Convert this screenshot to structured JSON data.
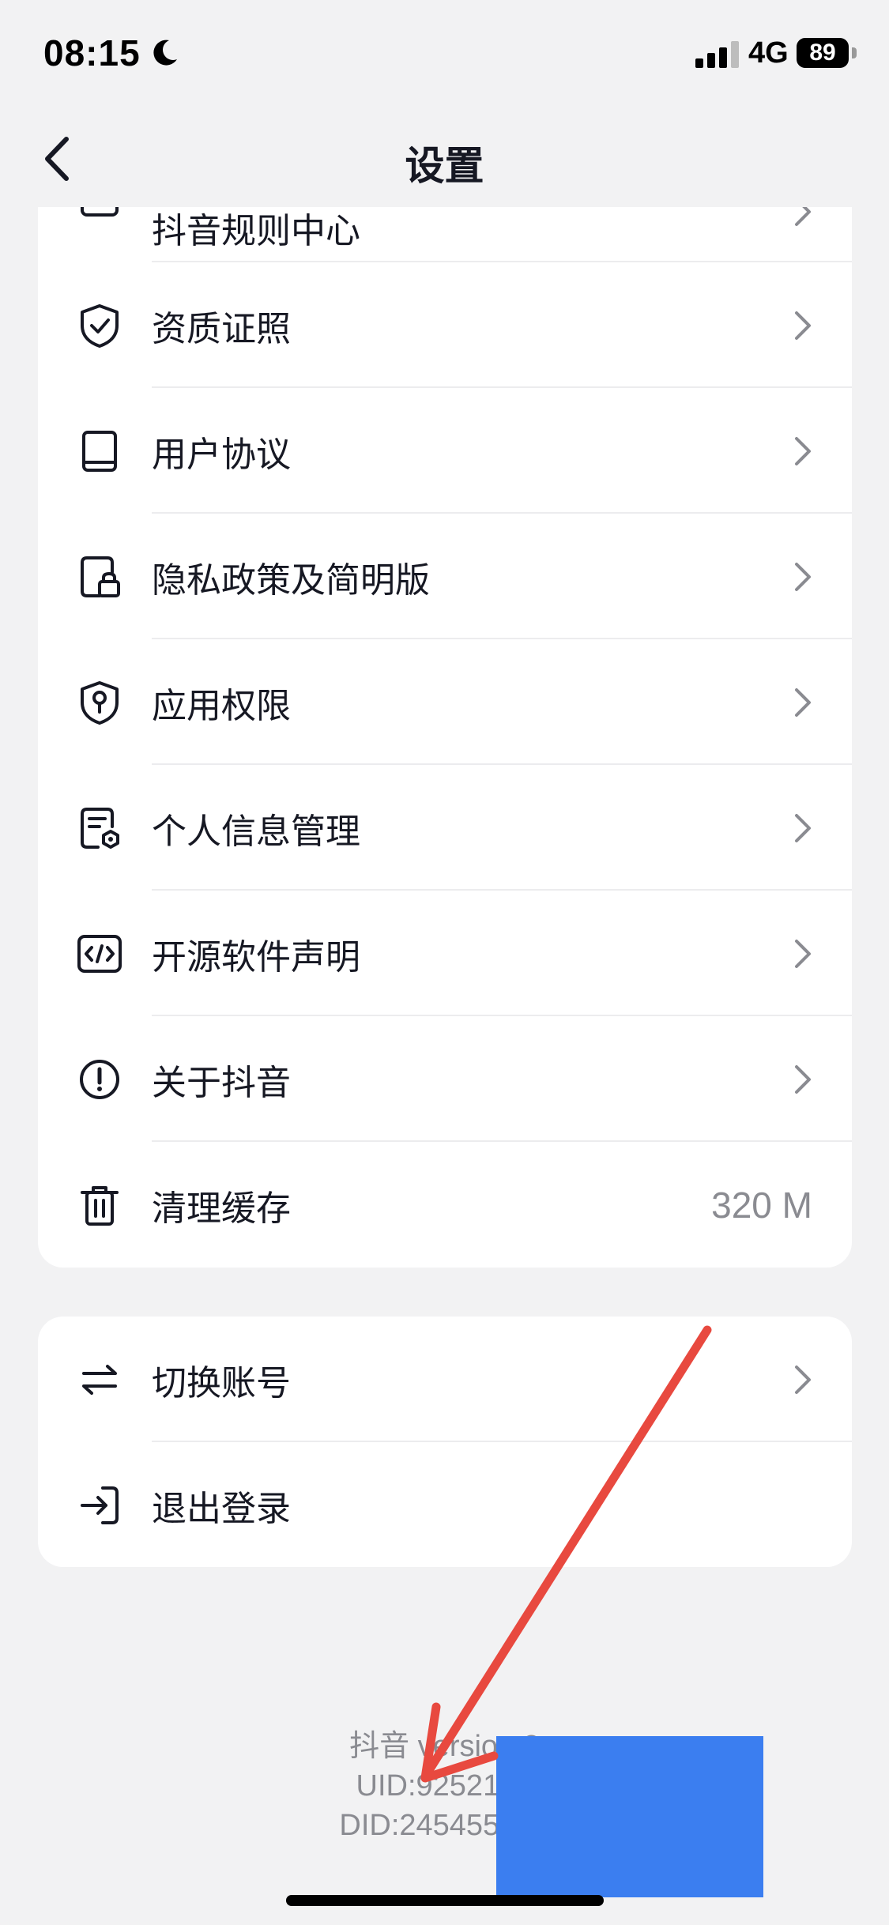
{
  "status_bar": {
    "time": "08:15",
    "network": "4G",
    "battery": "89"
  },
  "nav": {
    "title": "设置"
  },
  "settings_card": {
    "partial_item_label": "抖音规则中心",
    "items": [
      {
        "label": "资质证照",
        "icon": "shield-check-icon"
      },
      {
        "label": "用户协议",
        "icon": "book-icon"
      },
      {
        "label": "隐私政策及简明版",
        "icon": "document-lock-icon"
      },
      {
        "label": "应用权限",
        "icon": "shield-key-icon"
      },
      {
        "label": "个人信息管理",
        "icon": "document-gear-icon"
      },
      {
        "label": "开源软件声明",
        "icon": "code-icon"
      },
      {
        "label": "关于抖音",
        "icon": "info-circle-icon"
      },
      {
        "label": "清理缓存",
        "icon": "trash-icon",
        "value": "320 M"
      }
    ]
  },
  "account_card": {
    "items": [
      {
        "label": "切换账号",
        "icon": "swap-icon"
      },
      {
        "label": "退出登录",
        "icon": "logout-icon"
      }
    ]
  },
  "footer": {
    "version_line": "抖音 version 2",
    "uid_line": "UID:9252143",
    "did_line": "DID:245455233"
  },
  "colors": {
    "background": "#f2f2f3",
    "card": "#ffffff",
    "text_primary": "#161823",
    "text_secondary": "#8a8b91",
    "annotation_arrow": "#e8493f",
    "redaction": "#3b7ef0"
  }
}
